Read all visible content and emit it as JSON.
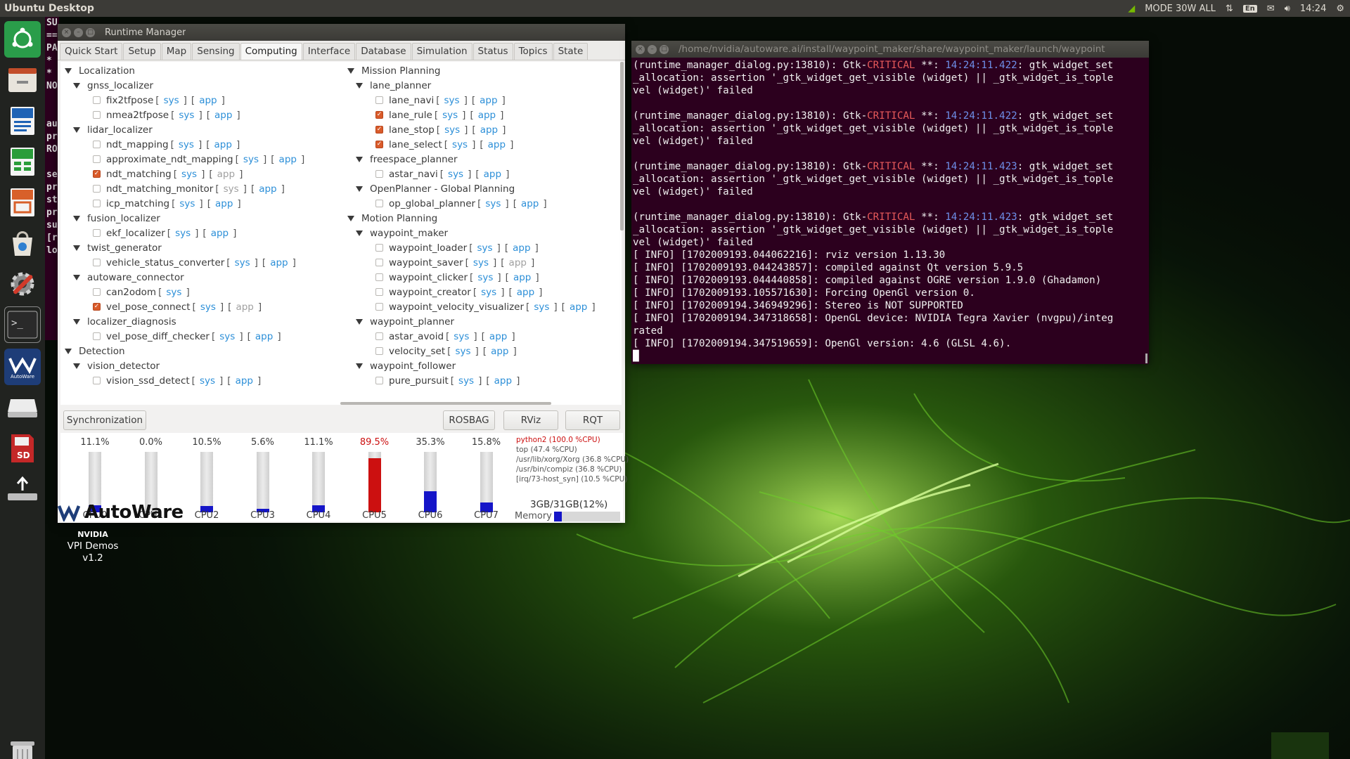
{
  "desktop": {
    "title": "Ubuntu Desktop",
    "tray": {
      "power_mode": "MODE 30W ALL",
      "keyboard": "En",
      "clock": "14:24"
    }
  },
  "launcher": {
    "icons": [
      "ubuntu-home-icon",
      "files-icon",
      "writer-icon",
      "calc-icon",
      "impress-icon",
      "software-center-icon",
      "system-settings-icon",
      "terminal-icon",
      "autoware-icon",
      "drive-icon",
      "sd-card-icon",
      "usb-drive-icon",
      "trash-icon"
    ],
    "autoware_label": "AutoWare",
    "sd_label": "SD"
  },
  "background_terminal": {
    "lines": [
      "SU",
      "==",
      "PA",
      "*",
      "*",
      "NO",
      "",
      "",
      "au",
      "pr",
      "RO",
      "",
      "se",
      "pr",
      "st",
      "pr",
      "su",
      "[r",
      "lo"
    ]
  },
  "runtime_manager": {
    "title": "Runtime Manager",
    "tabs": [
      "Quick Start",
      "Setup",
      "Map",
      "Sensing",
      "Computing",
      "Interface",
      "Database",
      "Simulation",
      "Status",
      "Topics",
      "State"
    ],
    "active_tab": "Computing",
    "labels": {
      "sys": "sys",
      "app": "app"
    },
    "left_tree": [
      {
        "level": 0,
        "type": "group",
        "label": "Localization"
      },
      {
        "level": 1,
        "type": "group",
        "label": "gnss_localizer"
      },
      {
        "level": 2,
        "type": "item",
        "label": "fix2tfpose",
        "checked": false,
        "app_enabled": true
      },
      {
        "level": 2,
        "type": "item",
        "label": "nmea2tfpose",
        "checked": false,
        "app_enabled": true
      },
      {
        "level": 1,
        "type": "group",
        "label": "lidar_localizer"
      },
      {
        "level": 2,
        "type": "item",
        "label": "ndt_mapping",
        "checked": false,
        "app_enabled": true
      },
      {
        "level": 2,
        "type": "item",
        "label": "approximate_ndt_mapping",
        "checked": false,
        "app_enabled": true
      },
      {
        "level": 2,
        "type": "item",
        "label": "ndt_matching",
        "checked": true,
        "app_enabled": false
      },
      {
        "level": 2,
        "type": "item",
        "label": "ndt_matching_monitor",
        "checked": false,
        "sys_enabled": false,
        "app_enabled": true
      },
      {
        "level": 2,
        "type": "item",
        "label": "icp_matching",
        "checked": false,
        "app_enabled": true
      },
      {
        "level": 1,
        "type": "group",
        "label": "fusion_localizer"
      },
      {
        "level": 2,
        "type": "item",
        "label": "ekf_localizer",
        "checked": false,
        "app_enabled": true
      },
      {
        "level": 1,
        "type": "group",
        "label": "twist_generator"
      },
      {
        "level": 2,
        "type": "item",
        "label": "vehicle_status_converter",
        "checked": false,
        "app_enabled": true
      },
      {
        "level": 1,
        "type": "group",
        "label": "autoware_connector"
      },
      {
        "level": 2,
        "type": "item",
        "label": "can2odom",
        "checked": false,
        "no_app": true
      },
      {
        "level": 2,
        "type": "item",
        "label": "vel_pose_connect",
        "checked": true,
        "app_enabled": false
      },
      {
        "level": 1,
        "type": "group",
        "label": "localizer_diagnosis"
      },
      {
        "level": 2,
        "type": "item",
        "label": "vel_pose_diff_checker",
        "checked": false,
        "app_enabled": true
      },
      {
        "level": 0,
        "type": "group",
        "label": "Detection"
      },
      {
        "level": 1,
        "type": "group",
        "label": "vision_detector"
      },
      {
        "level": 2,
        "type": "item",
        "label": "vision_ssd_detect",
        "checked": false,
        "app_enabled": true
      }
    ],
    "right_tree": [
      {
        "level": 0,
        "type": "group",
        "label": "Mission Planning"
      },
      {
        "level": 1,
        "type": "group",
        "label": "lane_planner"
      },
      {
        "level": 2,
        "type": "item",
        "label": "lane_navi",
        "checked": false,
        "app_enabled": true
      },
      {
        "level": 2,
        "type": "item",
        "label": "lane_rule",
        "checked": true,
        "app_enabled": true
      },
      {
        "level": 2,
        "type": "item",
        "label": "lane_stop",
        "checked": true,
        "app_enabled": true
      },
      {
        "level": 2,
        "type": "item",
        "label": "lane_select",
        "checked": true,
        "app_enabled": true
      },
      {
        "level": 1,
        "type": "group",
        "label": "freespace_planner"
      },
      {
        "level": 2,
        "type": "item",
        "label": "astar_navi",
        "checked": false,
        "app_enabled": true
      },
      {
        "level": 1,
        "type": "group",
        "label": "OpenPlanner - Global Planning"
      },
      {
        "level": 2,
        "type": "item",
        "label": "op_global_planner",
        "checked": false,
        "app_enabled": true
      },
      {
        "level": 0,
        "type": "group",
        "label": "Motion Planning"
      },
      {
        "level": 1,
        "type": "group",
        "label": "waypoint_maker"
      },
      {
        "level": 2,
        "type": "item",
        "label": "waypoint_loader",
        "checked": false,
        "app_enabled": true
      },
      {
        "level": 2,
        "type": "item",
        "label": "waypoint_saver",
        "checked": false,
        "app_enabled": false
      },
      {
        "level": 2,
        "type": "item",
        "label": "waypoint_clicker",
        "checked": false,
        "app_enabled": true
      },
      {
        "level": 2,
        "type": "item",
        "label": "waypoint_creator",
        "checked": false,
        "app_enabled": true
      },
      {
        "level": 2,
        "type": "item",
        "label": "waypoint_velocity_visualizer",
        "checked": false,
        "app_enabled": true
      },
      {
        "level": 1,
        "type": "group",
        "label": "waypoint_planner"
      },
      {
        "level": 2,
        "type": "item",
        "label": "astar_avoid",
        "checked": false,
        "app_enabled": true
      },
      {
        "level": 2,
        "type": "item",
        "label": "velocity_set",
        "checked": false,
        "app_enabled": true
      },
      {
        "level": 1,
        "type": "group",
        "label": "waypoint_follower"
      },
      {
        "level": 2,
        "type": "item",
        "label": "pure_pursuit",
        "checked": false,
        "app_enabled": true
      }
    ],
    "buttons": {
      "sync": "Synchronization",
      "rosbag": "ROSBAG",
      "rviz": "RViz",
      "rqt": "RQT"
    },
    "cpus": [
      {
        "name": "CPU0",
        "label": "11.1%",
        "value": 11.1
      },
      {
        "name": "CPU1",
        "label": "0.0%",
        "value": 0.0
      },
      {
        "name": "CPU2",
        "label": "10.5%",
        "value": 10.5
      },
      {
        "name": "CPU3",
        "label": "5.6%",
        "value": 5.6
      },
      {
        "name": "CPU4",
        "label": "11.1%",
        "value": 11.1
      },
      {
        "name": "CPU5",
        "label": "89.5%",
        "value": 89.5
      },
      {
        "name": "CPU6",
        "label": "35.3%",
        "value": 35.3
      },
      {
        "name": "CPU7",
        "label": "15.8%",
        "value": 15.8
      }
    ],
    "processes": [
      "python2 (100.0 %CPU)",
      "top (47.4 %CPU)",
      "/usr/lib/xorg/Xorg (36.8 %CPU)",
      "/usr/bin/compiz (36.8 %CPU)",
      "[irq/73-host_syn] (10.5 %CPU)"
    ],
    "memory": {
      "label": "Memory",
      "text": "3GB/31GB(12%)",
      "percent": 12
    },
    "colors": {
      "normal": "#1515c8",
      "high": "#cc1010",
      "checked": "#d95b2a",
      "link": "#2c8fd8"
    }
  },
  "logo": {
    "text": "AutoWare"
  },
  "nvidia_icon": {
    "brand": "NVIDIA",
    "line1": "VPI Demos",
    "line2": "v1.2"
  },
  "terminal": {
    "title": "/home/nvidia/autoware.ai/install/waypoint_maker/share/waypoint_maker/launch/waypoint",
    "lines": [
      [
        {
          "t": "(runtime_manager_dialog.py:13810): Gtk-"
        },
        {
          "t": "CRITICAL",
          "c": "crit"
        },
        {
          "t": " **: "
        },
        {
          "t": "14:24:11.422",
          "c": "ts"
        },
        {
          "t": ": gtk_widget_set"
        }
      ],
      [
        {
          "t": "_allocation: assertion '_gtk_widget_get_visible (widget) || _gtk_widget_is_tople"
        }
      ],
      [
        {
          "t": "vel (widget)' failed"
        }
      ],
      [
        {
          "t": ""
        }
      ],
      [
        {
          "t": "(runtime_manager_dialog.py:13810): Gtk-"
        },
        {
          "t": "CRITICAL",
          "c": "crit"
        },
        {
          "t": " **: "
        },
        {
          "t": "14:24:11.422",
          "c": "ts"
        },
        {
          "t": ": gtk_widget_set"
        }
      ],
      [
        {
          "t": "_allocation: assertion '_gtk_widget_get_visible (widget) || _gtk_widget_is_tople"
        }
      ],
      [
        {
          "t": "vel (widget)' failed"
        }
      ],
      [
        {
          "t": ""
        }
      ],
      [
        {
          "t": "(runtime_manager_dialog.py:13810): Gtk-"
        },
        {
          "t": "CRITICAL",
          "c": "crit"
        },
        {
          "t": " **: "
        },
        {
          "t": "14:24:11.423",
          "c": "ts"
        },
        {
          "t": ": gtk_widget_set"
        }
      ],
      [
        {
          "t": "_allocation: assertion '_gtk_widget_get_visible (widget) || _gtk_widget_is_tople"
        }
      ],
      [
        {
          "t": "vel (widget)' failed"
        }
      ],
      [
        {
          "t": ""
        }
      ],
      [
        {
          "t": "(runtime_manager_dialog.py:13810): Gtk-"
        },
        {
          "t": "CRITICAL",
          "c": "crit"
        },
        {
          "t": " **: "
        },
        {
          "t": "14:24:11.423",
          "c": "ts"
        },
        {
          "t": ": gtk_widget_set"
        }
      ],
      [
        {
          "t": "_allocation: assertion '_gtk_widget_get_visible (widget) || _gtk_widget_is_tople"
        }
      ],
      [
        {
          "t": "vel (widget)' failed"
        }
      ],
      [
        {
          "t": "[ INFO] [1702009193.044062216]: rviz version 1.13.30"
        }
      ],
      [
        {
          "t": "[ INFO] [1702009193.044243857]: compiled against Qt version 5.9.5"
        }
      ],
      [
        {
          "t": "[ INFO] [1702009193.044440858]: compiled against OGRE version 1.9.0 (Ghadamon)"
        }
      ],
      [
        {
          "t": "[ INFO] [1702009193.105571630]: Forcing OpenGl version 0."
        }
      ],
      [
        {
          "t": "[ INFO] [1702009194.346949296]: Stereo is NOT SUPPORTED"
        }
      ],
      [
        {
          "t": "[ INFO] [1702009194.347318658]: OpenGL device: NVIDIA Tegra Xavier (nvgpu)/integ"
        }
      ],
      [
        {
          "t": "rated"
        }
      ],
      [
        {
          "t": "[ INFO] [1702009194.347519659]: OpenGl version: 4.6 (GLSL 4.6)."
        }
      ]
    ]
  }
}
